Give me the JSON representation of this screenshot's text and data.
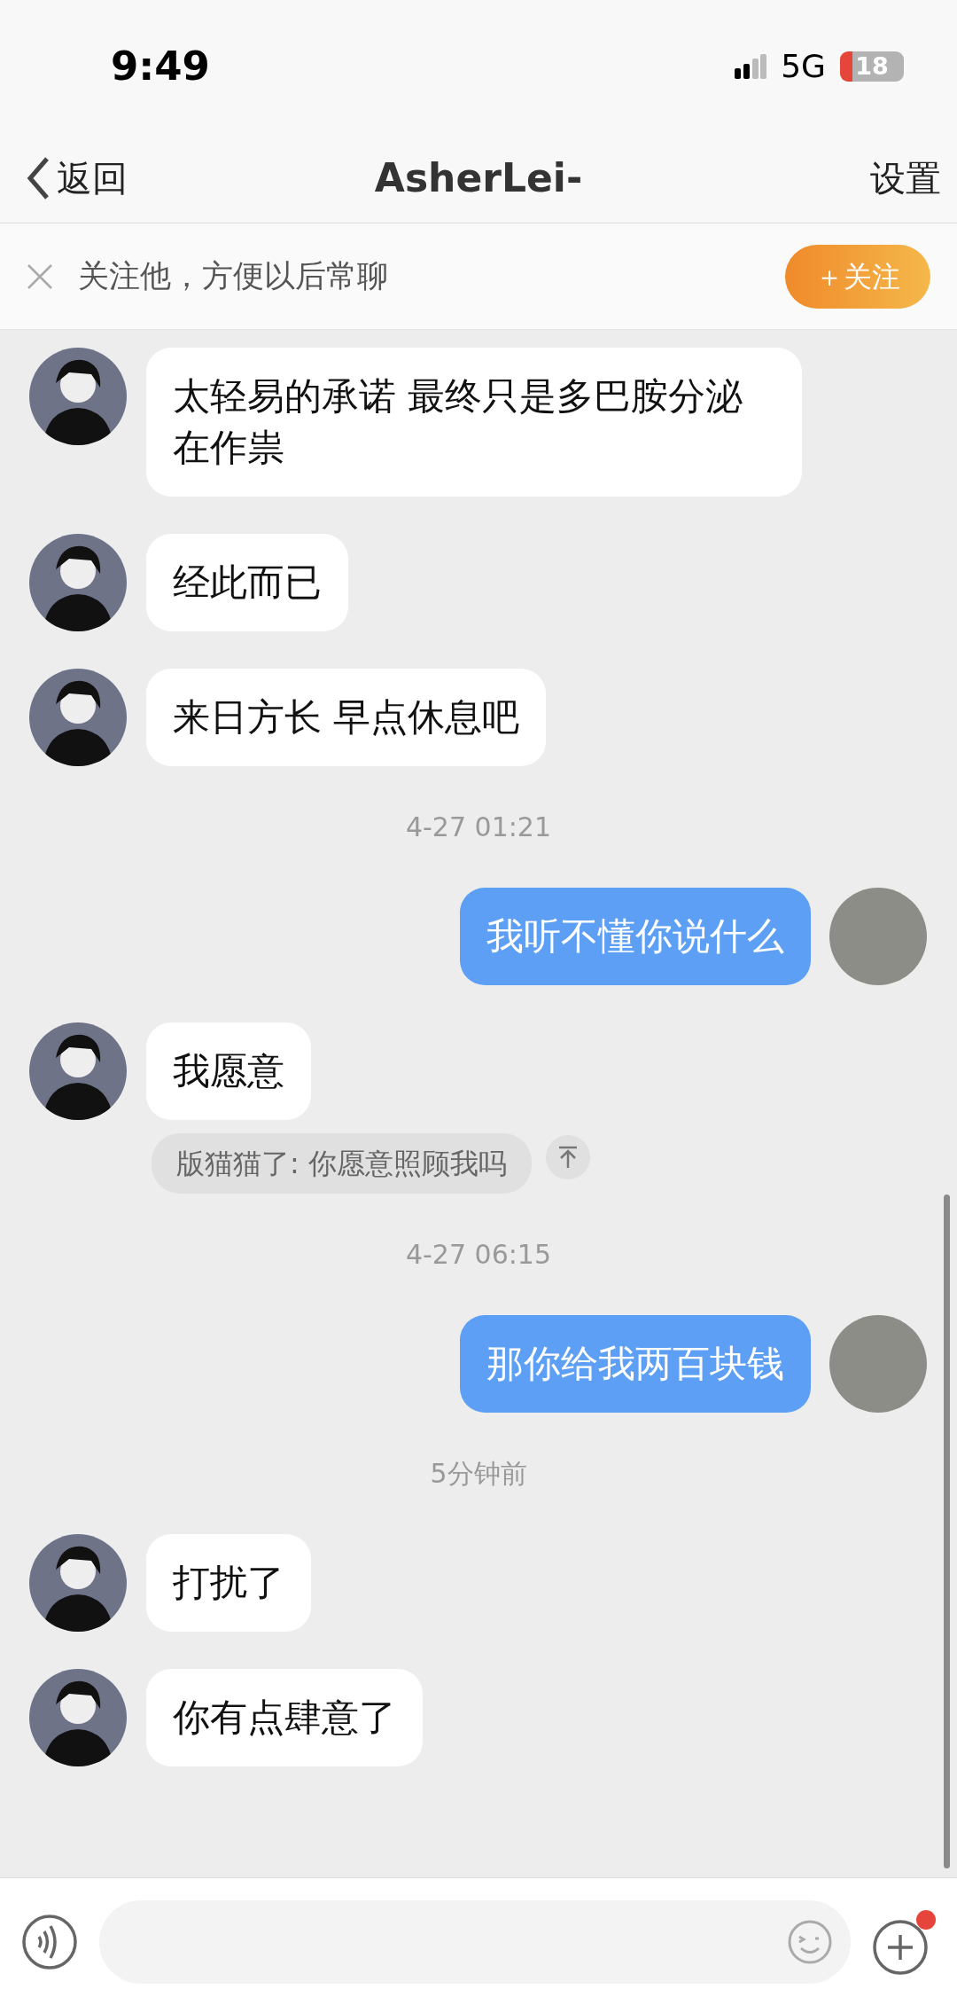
{
  "status_bar": {
    "time": "9:49",
    "network": "5G",
    "battery": "18"
  },
  "nav": {
    "back": "返回",
    "title": "AsherLei-",
    "settings": "设置"
  },
  "follow_banner": {
    "text": "关注他，方便以后常聊",
    "button": "＋关注"
  },
  "messages": [
    {
      "kind": "incoming",
      "text": "太轻易的承诺 最终只是多巴胺分泌在作祟"
    },
    {
      "kind": "incoming",
      "text": "经此而已"
    },
    {
      "kind": "incoming",
      "text": "来日方长 早点休息吧"
    },
    {
      "kind": "time",
      "text": "4-27 01:21"
    },
    {
      "kind": "outgoing",
      "text": "我听不懂你说什么"
    },
    {
      "kind": "incoming",
      "text": "我愿意",
      "quote": "版猫猫了: 你愿意照顾我吗"
    },
    {
      "kind": "time",
      "text": "4-27 06:15"
    },
    {
      "kind": "outgoing",
      "text": "那你给我两百块钱"
    },
    {
      "kind": "time",
      "text": "5分钟前"
    },
    {
      "kind": "incoming",
      "text": "打扰了"
    },
    {
      "kind": "incoming",
      "text": "你有点肆意了"
    }
  ],
  "input_bar": {
    "plus_badge": true
  }
}
